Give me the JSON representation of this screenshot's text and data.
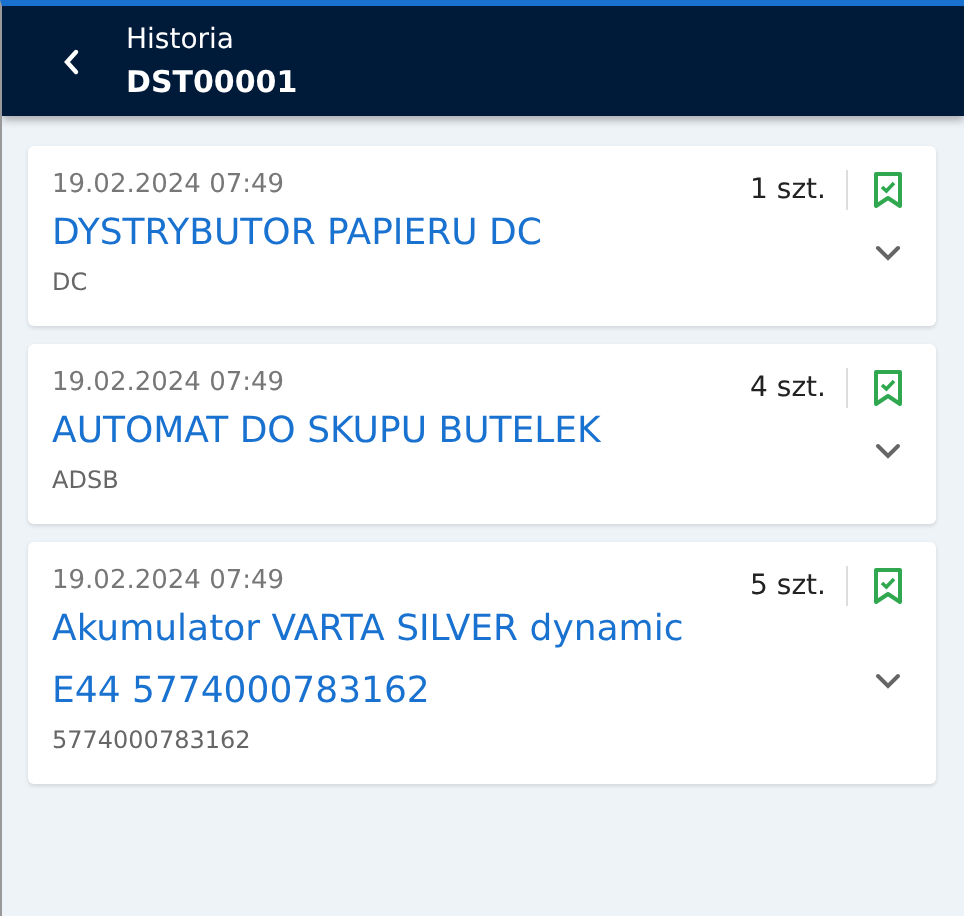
{
  "header": {
    "title": "Historia",
    "subtitle": "DST00001"
  },
  "items": [
    {
      "date": "19.02.2024 07:49",
      "quantity": "1 szt.",
      "name": "DYSTRYBUTOR PAPIERU DC",
      "code": "DC"
    },
    {
      "date": "19.02.2024 07:49",
      "quantity": "4 szt.",
      "name": "AUTOMAT DO SKUPU BUTELEK",
      "code": "ADSB"
    },
    {
      "date": "19.02.2024 07:49",
      "quantity": "5 szt.",
      "name": "Akumulator VARTA SILVER dynamic E44 5774000783162",
      "code": "5774000783162"
    }
  ]
}
